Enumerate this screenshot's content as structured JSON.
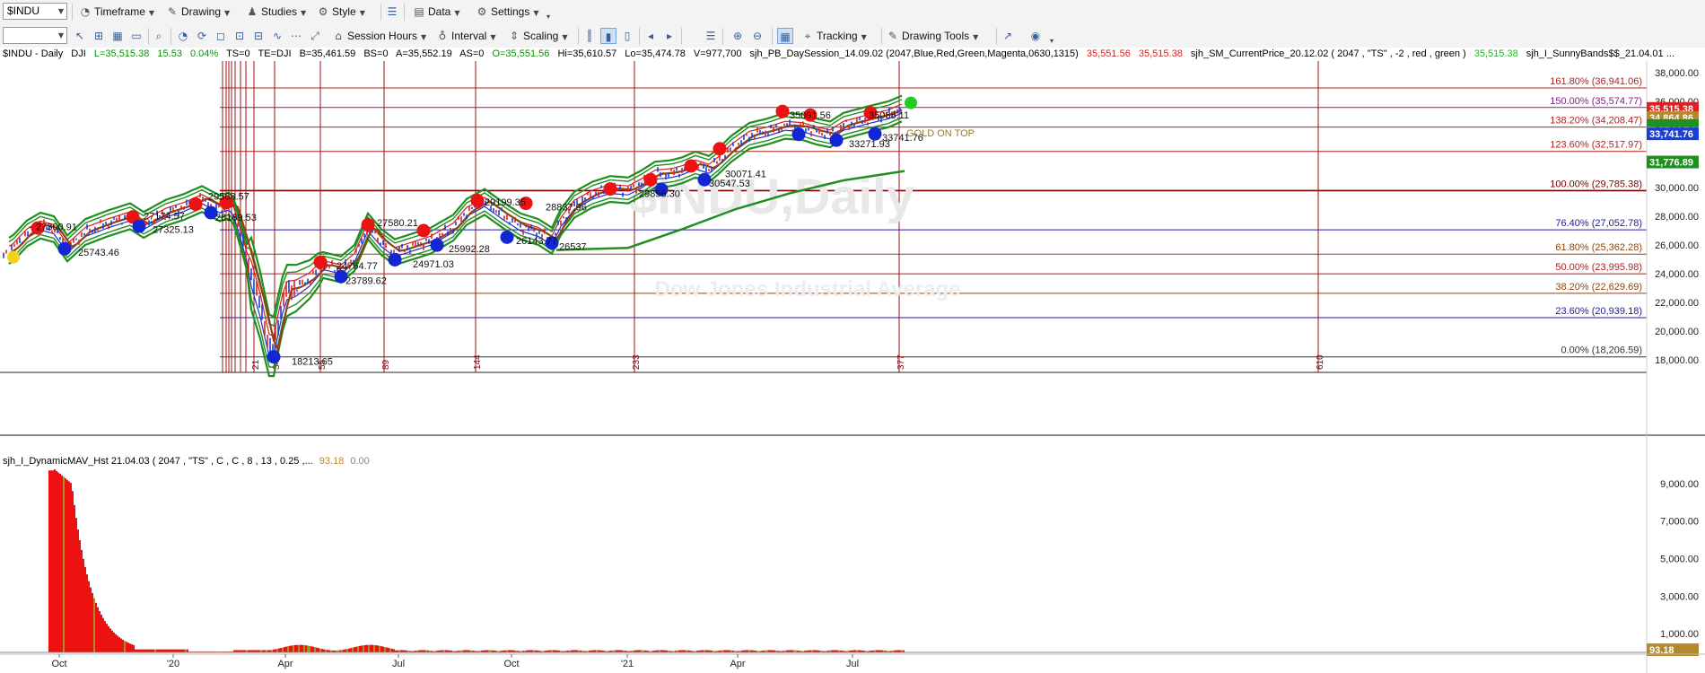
{
  "toolbar1": {
    "symbol": "$INDU",
    "timeframe": "Timeframe",
    "drawing": "Drawing",
    "studies": "Studies",
    "style": "Style",
    "data": "Data",
    "settings": "Settings"
  },
  "toolbar2": {
    "session_hours": "Session Hours",
    "interval": "Interval",
    "scaling": "Scaling",
    "tracking": "Tracking",
    "drawing_tools": "Drawing Tools"
  },
  "infobar": {
    "symbol": "$INDU - Daily",
    "exchange": "DJI",
    "last": "L=35,515.38",
    "change": "15.53",
    "pct": "0.04%",
    "ts": "TS=0",
    "te": "TE=DJI",
    "bid": "B=35,461.59",
    "bs": "BS=0",
    "ask": "A=35,552.19",
    "as": "AS=0",
    "open": "O=35,551.56",
    "high": "Hi=35,610.57",
    "low": "Lo=35,474.78",
    "volume": "V=977,700",
    "study1": "sjh_PB_DaySession_14.09.02 (2047,Blue,Red,Green,Magenta,0630,1315)",
    "study1_v1": "35,551.56",
    "study1_v2": "35,515.38",
    "study2": "sjh_SM_CurrentPrice_20.12.02 ( 2047 , \"TS\" , -2 , red , green )",
    "study2_v1": "35,515.38",
    "study3": "sjh_I_SunnyBands$$_21.04.01 ..."
  },
  "watermark": {
    "symbol": "$INDU,Daily",
    "name": "Dow Jones Industrial Average"
  },
  "price_axis": [
    "38,000.00",
    "36,000.00",
    "34,000.00",
    "32,000.00",
    "30,000.00",
    "28,000.00",
    "26,000.00",
    "24,000.00",
    "22,000.00",
    "20,000.00",
    "18,000.00"
  ],
  "price_badges": [
    {
      "text": "35,515.38",
      "bg": "#e02020"
    },
    {
      "text": "34,864.86",
      "bg": "#b5892a"
    },
    {
      "text": "33,741.76",
      "bg": "#1a3fd9"
    },
    {
      "text": "31,776.89",
      "bg": "#1f8f1f"
    }
  ],
  "fib_levels": [
    {
      "label": "161.80% (36,941.06)",
      "value": 36941.06,
      "color": "#b22222"
    },
    {
      "label": "150.00% (35,574.77)",
      "value": 35574.77,
      "color": "#8b1a8b"
    },
    {
      "label": "138.20% (34,208.47)",
      "value": 34208.47,
      "color": "#b22222"
    },
    {
      "label": "123.60% (32,517.97)",
      "value": 32517.97,
      "color": "#b22222"
    },
    {
      "label": "100.00% (29,785.38)",
      "value": 29785.38,
      "color": "#7a0000"
    },
    {
      "label": "76.40% (27,052.78)",
      "value": 27052.78,
      "color": "#1a1aa6"
    },
    {
      "label": "61.80% (25,362.28)",
      "value": 25362.28,
      "color": "#8b4513"
    },
    {
      "label": "50.00% (23,995.98)",
      "value": 23995.98,
      "color": "#b22222"
    },
    {
      "label": "38.20% (22,629.69)",
      "value": 22629.69,
      "color": "#8b4513"
    },
    {
      "label": "23.60% (20,939.18)",
      "value": 20939.18,
      "color": "#1a1aa6"
    },
    {
      "label": "0.00% (18,206.59)",
      "value": 18206.59,
      "color": "#333333"
    }
  ],
  "fib_time_labels": [
    "21",
    "34",
    "55",
    "89",
    "144",
    "233",
    "377",
    "610"
  ],
  "date_axis": [
    "Oct",
    "'20",
    "Apr",
    "Jul",
    "Oct",
    "'21",
    "Apr",
    "Jul"
  ],
  "swing_labels": [
    "25743.46",
    "27325.13",
    "28169.53",
    "18213.65",
    "23789.62",
    "24971.03",
    "25992.28",
    "26143.77",
    "26537",
    "29856.30",
    "30547.53",
    "33271.93",
    "33741.76",
    "27300.91",
    "27174.57",
    "29568.57",
    "27580.21",
    "29199.35",
    "28837.96",
    "30071.41",
    "35091.56",
    "35085.11",
    "24764.77"
  ],
  "annotation": "GOLD ON TOP",
  "subchart": {
    "title": "sjh_I_DynamicMAV_Hst 21.04.03 ( 2047 , \"TS\" , C , C , 8 , 13 , 0.25 ,...",
    "v1": "93.18",
    "v2": "0.00",
    "axis": [
      "9,000.00",
      "7,000.00",
      "5,000.00",
      "3,000.00",
      "1,000.00"
    ],
    "badge": "93.18"
  },
  "colors": {
    "up": "#1a3fd9",
    "down": "#e02020",
    "band": "#1f8f1f",
    "mav": "#8b4513",
    "sma": "#1f8f1f"
  }
}
